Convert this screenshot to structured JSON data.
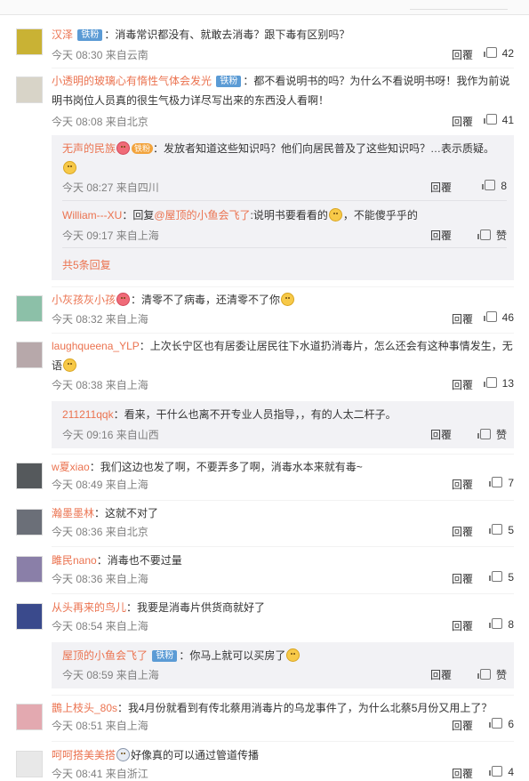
{
  "colors": {
    "name": "#eb7350",
    "badge": "#5b9bd5",
    "fan": "#f2a33c",
    "subbg": "#f2f2f5"
  },
  "icons": {
    "like": "thumbs-up-icon",
    "avatar": "avatar-image"
  },
  "comments": [
    {
      "name": "汉泽",
      "badge": "铁粉",
      "text": "：消毒常识都没有、就敢去消毒？跟下毒有区别吗？",
      "time": "今天 08:30 来自云南",
      "reply": "回覆",
      "likes": "42",
      "avatar_color": "#c9b234"
    },
    {
      "name": "小透明的玻璃心有惰性气体会发光",
      "badge": "铁粉",
      "text": "：都不看说明书的吗？为什么不看说明书呀！我作为前说明书岗位人员真的很生气极力详尽写出来的东西没人看啊！",
      "time": "今天 08:08 来自北京",
      "reply": "回覆",
      "likes": "41",
      "avatar_color": "#d8d4c8",
      "subreplies": [
        {
          "name": "无声的民族",
          "fan": "铁粉",
          "text": "：发放者知道这些知识吗？他们向居民普及了这些知识吗？…表示质疑。",
          "time": "今天 08:27 来自四川",
          "reply": "回覆",
          "likes": "8"
        },
        {
          "name": "William---XU",
          "text_prefix": "：回复",
          "mention": "@屋顶的小鱼会飞了",
          "text": ":说明书要看看的",
          "text_suffix": "，不能傻乎乎的",
          "time": "今天 09:17 来自上海",
          "reply": "回覆",
          "likes": "赞"
        }
      ],
      "more": "共5条回复"
    },
    {
      "name": "小灰孩灰小孩",
      "text": "：清零不了病毒，还清零不了你",
      "time": "今天 08:32 来自上海",
      "reply": "回覆",
      "likes": "46",
      "avatar_color": "#8cc0a8"
    },
    {
      "name": "laughqueena_YLP",
      "text": "：上次长宁区也有居委让居民往下水道扔消毒片，怎么还会有这种事情发生，无语",
      "time": "今天 08:38 来自上海",
      "reply": "回覆",
      "likes": "13",
      "avatar_color": "#b7a8aa",
      "subreplies": [
        {
          "name": "211211qqk",
          "text": "：看来，干什么也离不开专业人员指导，，有的人太二杆子。",
          "time": "今天 09:16 来自山西",
          "reply": "回覆",
          "likes": "赞"
        }
      ]
    },
    {
      "name": "w夏xiao",
      "text": "：我们这边也发了啊，不要弄多了啊，消毒水本来就有毒~",
      "time": "今天 08:49 来自上海",
      "reply": "回覆",
      "likes": "7",
      "avatar_color": "#55595c"
    },
    {
      "name": "瀚墨墨林",
      "text": "：这就不对了",
      "time": "今天 08:36 来自北京",
      "reply": "回覆",
      "likes": "5",
      "avatar_color": "#6b6f78"
    },
    {
      "name": "雎民nano",
      "text": "：消毒也不要过量",
      "time": "今天 08:36 来自上海",
      "reply": "回覆",
      "likes": "5",
      "avatar_color": "#8a7fa8"
    },
    {
      "name": "从头再来的鸟儿",
      "text": "：我要是消毒片供货商就好了",
      "time": "今天 08:54 来自上海",
      "reply": "回覆",
      "likes": "8",
      "avatar_color": "#3a4a8c",
      "subreplies": [
        {
          "name": "屋顶的小鱼会飞了",
          "badge": "铁粉",
          "text": "：你马上就可以买房了",
          "time": "今天 08:59 来自上海",
          "reply": "回覆",
          "likes": "赞"
        }
      ]
    },
    {
      "name": "鵲上枝头_80s",
      "text": "：我4月份就看到有传北蔡用消毒片的乌龙事件了，为什么北蔡5月份又用上了？",
      "time": "今天 08:51 来自上海",
      "reply": "回覆",
      "likes": "6",
      "avatar_color": "#e3a9b0"
    },
    {
      "name": "呵呵搭美美搭",
      "text": "好像真的可以通过管道传播",
      "time": "今天 08:41 来自浙江",
      "reply": "回覆",
      "likes": "4",
      "avatar_color": "#e8e8e8"
    }
  ]
}
